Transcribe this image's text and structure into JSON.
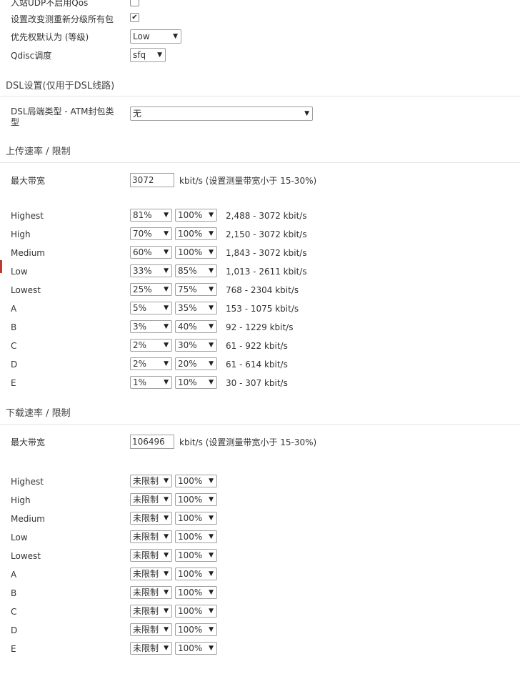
{
  "qos_top": {
    "udp_label": "入站UDP不启用Qos",
    "udp_checked": false,
    "reclassify_label": "设置改变测重新分级所有包",
    "reclassify_checked": true,
    "priority_label": "优先权默认为 (等级)",
    "priority_value": "Low",
    "qdisc_label": "Qdisc调度",
    "qdisc_value": "sfq"
  },
  "dsl": {
    "title": "DSL设置(仅用于DSL线路)",
    "type_label": "DSL局端类型 - ATM封包类型",
    "type_value": "无"
  },
  "upload": {
    "title": "上传速率 / 限制",
    "max_label": "最大带宽",
    "max_value": "3072",
    "max_unit": "kbit/s (设置测量带宽小于 15-30%)",
    "rows": [
      {
        "name": "Highest",
        "min": "81%",
        "max": "100%",
        "range": "2,488 - 3072 kbit/s"
      },
      {
        "name": "High",
        "min": "70%",
        "max": "100%",
        "range": "2,150 - 3072 kbit/s"
      },
      {
        "name": "Medium",
        "min": "60%",
        "max": "100%",
        "range": "1,843 - 3072 kbit/s"
      },
      {
        "name": "Low",
        "min": "33%",
        "max": "85%",
        "range": "1,013 - 2611 kbit/s"
      },
      {
        "name": "Lowest",
        "min": "25%",
        "max": "75%",
        "range": "768 - 2304 kbit/s"
      },
      {
        "name": "A",
        "min": "5%",
        "max": "35%",
        "range": "153 - 1075 kbit/s"
      },
      {
        "name": "B",
        "min": "3%",
        "max": "40%",
        "range": "92 - 1229 kbit/s"
      },
      {
        "name": "C",
        "min": "2%",
        "max": "30%",
        "range": "61 - 922 kbit/s"
      },
      {
        "name": "D",
        "min": "2%",
        "max": "20%",
        "range": "61 - 614 kbit/s"
      },
      {
        "name": "E",
        "min": "1%",
        "max": "10%",
        "range": "30 - 307 kbit/s"
      }
    ]
  },
  "download": {
    "title": "下载速率 / 限制",
    "max_label": "最大带宽",
    "max_value": "106496",
    "max_unit": "kbit/s (设置测量带宽小于 15-30%)",
    "rows": [
      {
        "name": "Highest",
        "min": "未限制",
        "max": "100%"
      },
      {
        "name": "High",
        "min": "未限制",
        "max": "100%"
      },
      {
        "name": "Medium",
        "min": "未限制",
        "max": "100%"
      },
      {
        "name": "Low",
        "min": "未限制",
        "max": "100%"
      },
      {
        "name": "Lowest",
        "min": "未限制",
        "max": "100%"
      },
      {
        "name": "A",
        "min": "未限制",
        "max": "100%"
      },
      {
        "name": "B",
        "min": "未限制",
        "max": "100%"
      },
      {
        "name": "C",
        "min": "未限制",
        "max": "100%"
      },
      {
        "name": "D",
        "min": "未限制",
        "max": "100%"
      },
      {
        "name": "E",
        "min": "未限制",
        "max": "100%"
      }
    ]
  }
}
